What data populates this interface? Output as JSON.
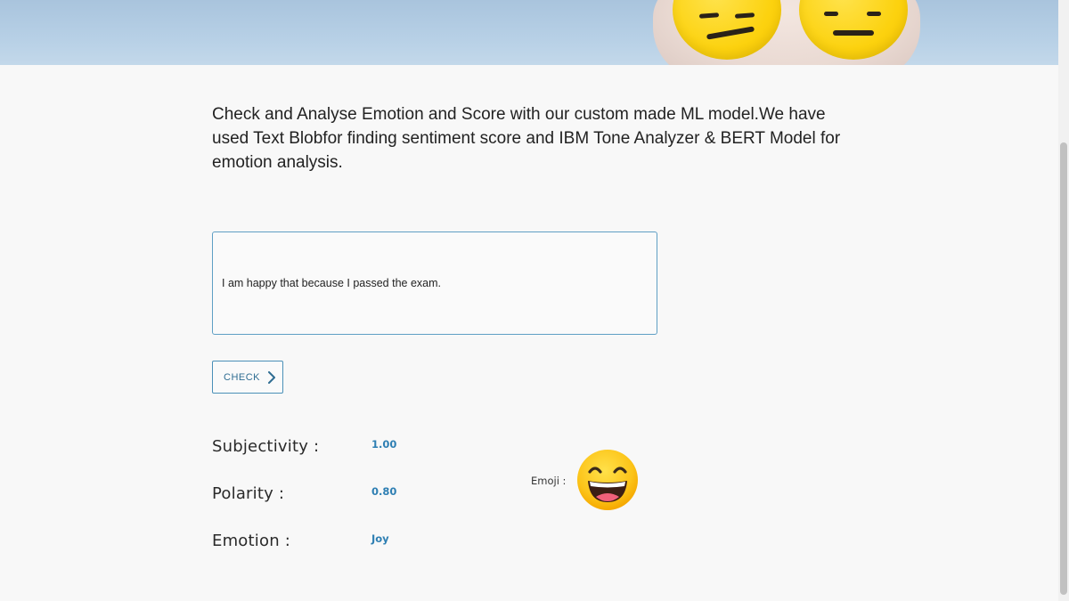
{
  "intro": {
    "text": "Check and Analyse Emotion and Score with our custom made ML model.We have used Text Blobfor finding sentiment score and IBM Tone Analyzer & BERT Model for emotion analysis."
  },
  "input": {
    "value": "I am happy that because I passed the exam.",
    "placeholder": ""
  },
  "check_button": {
    "label": "CHECK",
    "icon": "chevron-right-icon"
  },
  "results": {
    "subjectivity_label": "Subjectivity :",
    "subjectivity_value": "1.00",
    "polarity_label": "Polarity :",
    "polarity_value": "0.80",
    "emotion_label": "Emotion :",
    "emotion_value": "Joy",
    "emoji_label": "Emoji :",
    "emoji_icon": "grinning-face-icon"
  },
  "colors": {
    "accent": "#2e7fb3",
    "border": "#5f9fc4",
    "background": "#f8f8f8"
  }
}
